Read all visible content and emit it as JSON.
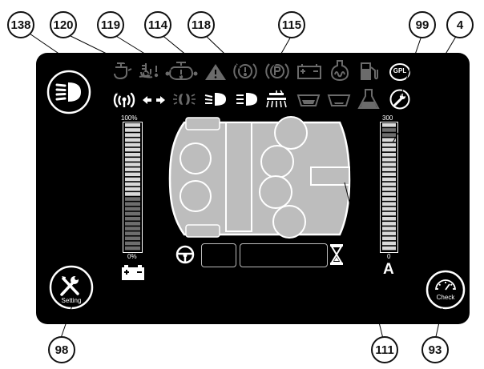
{
  "callouts": {
    "c138": "138",
    "c120": "120",
    "c119": "119",
    "c114": "114",
    "c118": "118",
    "c115": "115",
    "c99": "99",
    "c4": "4",
    "c98": "98",
    "c111": "111",
    "c93": "93"
  },
  "icons": {
    "gpl_label": "GPL"
  },
  "left_gauge": {
    "top_label": "100%",
    "bottom_label": "0%"
  },
  "right_gauge": {
    "top_label": "300",
    "bottom_label": "0",
    "unit_label": "A"
  },
  "buttons": {
    "setting_label": "Setting",
    "check_label": "Check"
  },
  "colors": {
    "screen": "#000000",
    "icon_dim": "#6b6b6b",
    "icon_bright": "#ffffff",
    "gauge_light": "#d9d9d9",
    "gauge_dark": "#6e6e6e",
    "chassis_fill": "#bdbdbd"
  }
}
